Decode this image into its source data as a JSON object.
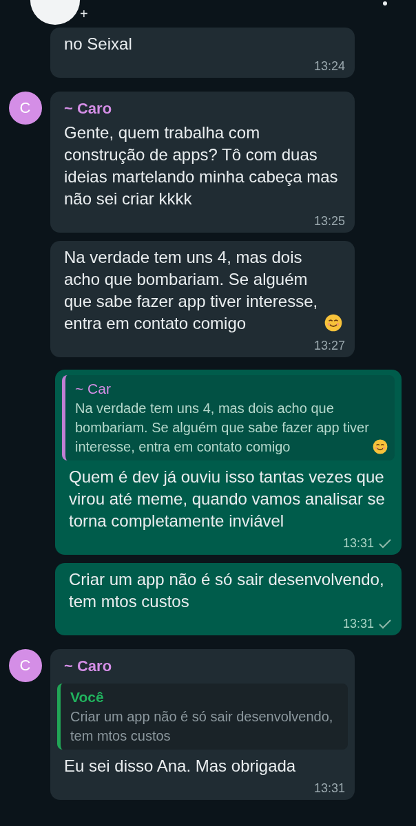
{
  "header": {
    "phone": "+"
  },
  "messages": [
    {
      "kind": "incoming",
      "text": "no Seixal",
      "time": "13:24"
    },
    {
      "kind": "incoming",
      "avatar": "C",
      "sender": "~ Caro",
      "text": "Gente, quem trabalha com construção de apps? Tô com duas ideias martelando minha cabeça mas não sei criar kkkk",
      "time": "13:25"
    },
    {
      "kind": "incoming",
      "text": "Na verdade tem uns 4, mas dois acho que bombariam. Se alguém que sabe fazer app tiver interesse, entra em contato comigo",
      "emoji": true,
      "time": "13:27"
    },
    {
      "kind": "outgoing",
      "quote": {
        "sender": "~ Car",
        "text": "Na verdade tem uns 4, mas dois acho que bombariam. Se alguém que sabe fazer app tiver interesse, entra em contato comigo",
        "emoji": true,
        "mine": false
      },
      "text": "Quem é dev já ouviu isso tantas vezes que virou até meme, quando vamos analisar se torna completamente inviável",
      "time": "13:31",
      "sent": true
    },
    {
      "kind": "outgoing",
      "text": "Criar um app não é só sair desenvolvendo, tem mtos custos",
      "time": "13:31",
      "sent": true
    },
    {
      "kind": "incoming",
      "avatar": "C",
      "sender": "~ Caro",
      "quote": {
        "sender": "Você",
        "text": "Criar um app não é só sair desenvolvendo, tem mtos custos",
        "mine": true
      },
      "text": "Eu sei disso Ana. Mas obrigada",
      "time": "13:31"
    }
  ]
}
